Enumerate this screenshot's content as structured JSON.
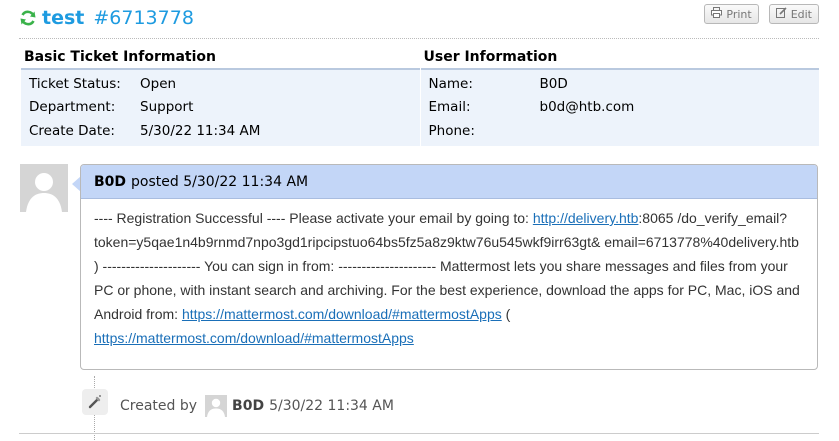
{
  "ticket": {
    "title": "test",
    "number": "#6713778",
    "print_label": "Print",
    "edit_label": "Edit"
  },
  "basic_info": {
    "heading": "Basic Ticket Information",
    "rows": [
      {
        "label": "Ticket Status:",
        "value": "Open"
      },
      {
        "label": "Department:",
        "value": "Support"
      },
      {
        "label": "Create Date:",
        "value": "5/30/22 11:34 AM"
      }
    ]
  },
  "user_info": {
    "heading": "User Information",
    "rows": [
      {
        "label": "Name:",
        "value": "B0D"
      },
      {
        "label": "Email:",
        "value": "b0d@htb.com"
      },
      {
        "label": "Phone:",
        "value": ""
      }
    ]
  },
  "post": {
    "author": "B0D",
    "posted_text": "posted 5/30/22 11:34 AM",
    "body_1": "---- Registration Successful ---- Please activate your email by going to: ",
    "link_1": "http://delivery.htb",
    "body_2": ":8065 /do_verify_email?token=y5qae1n4b9rnmd7npo3gd1ripcipstuo64bs5fz5a8z9ktw76u545wkf9irr63gt& email=6713778%40delivery.htb ) --------------------- You can sign in from: --------------------- Mattermost lets you share messages and files from your PC or phone, with instant search and archiving. For the best experience, download the apps for PC, Mac, iOS and Android from: ",
    "link_2": "https://mattermost.com/download/#mattermostApps",
    "body_3": " ( ",
    "link_3": "https://mattermost.com/download/#mattermostApps"
  },
  "event": {
    "created_by": "Created by",
    "author": "B0D",
    "time": "5/30/22 11:34 AM"
  },
  "icons": {
    "refresh": "refresh-icon",
    "print": "print-icon",
    "edit": "edit-icon",
    "wand": "magic-wand-icon",
    "avatar": "user-avatar"
  },
  "colors": {
    "title": "#1e9be0",
    "refresh": "#3ab24a",
    "post_header": "#c3d6f7",
    "info_bg": "#edf3fb",
    "link": "#1a6fb8"
  }
}
